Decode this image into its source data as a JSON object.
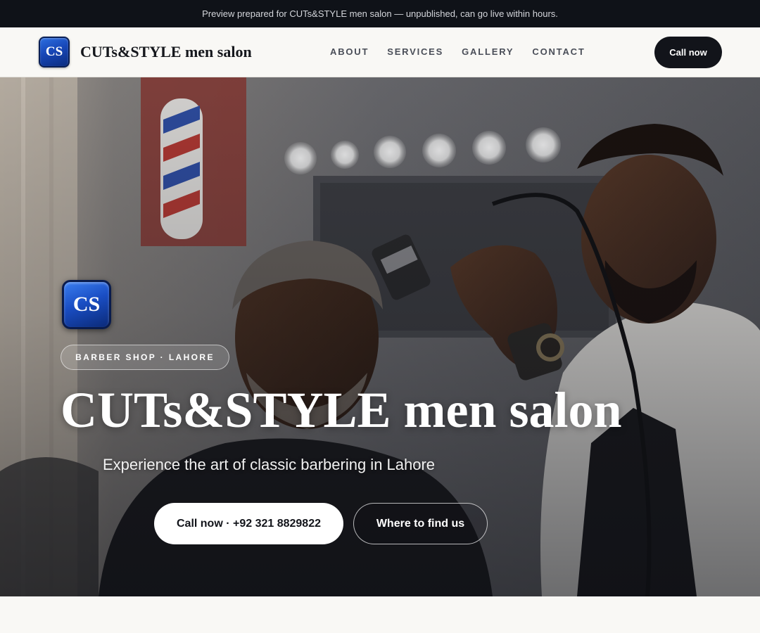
{
  "announcement": {
    "text": "Preview prepared for CUTs&STYLE men salon — unpublished, can go live within hours."
  },
  "header": {
    "logo_text": "CS",
    "brand_name": "CUTs&STYLE men salon",
    "nav": [
      {
        "label": "ABOUT"
      },
      {
        "label": "SERVICES"
      },
      {
        "label": "GALLERY"
      },
      {
        "label": "CONTACT"
      }
    ],
    "cta_label": "Call now"
  },
  "hero": {
    "logo_text": "CS",
    "badge": "BARBER SHOP · LAHORE",
    "title": "CUTs&STYLE men salon",
    "subtitle": "Experience the art of classic barbering in Lahore",
    "primary_button": "Call now · +92 321 8829822",
    "secondary_button": "Where to find us",
    "image": "hero-photo-barber-trimming-client"
  },
  "colors": {
    "dark": "#12141a",
    "announcement_bg": "#0f1218",
    "page_bg": "#f9f8f5",
    "logo_blue": "#1a4ec4"
  }
}
